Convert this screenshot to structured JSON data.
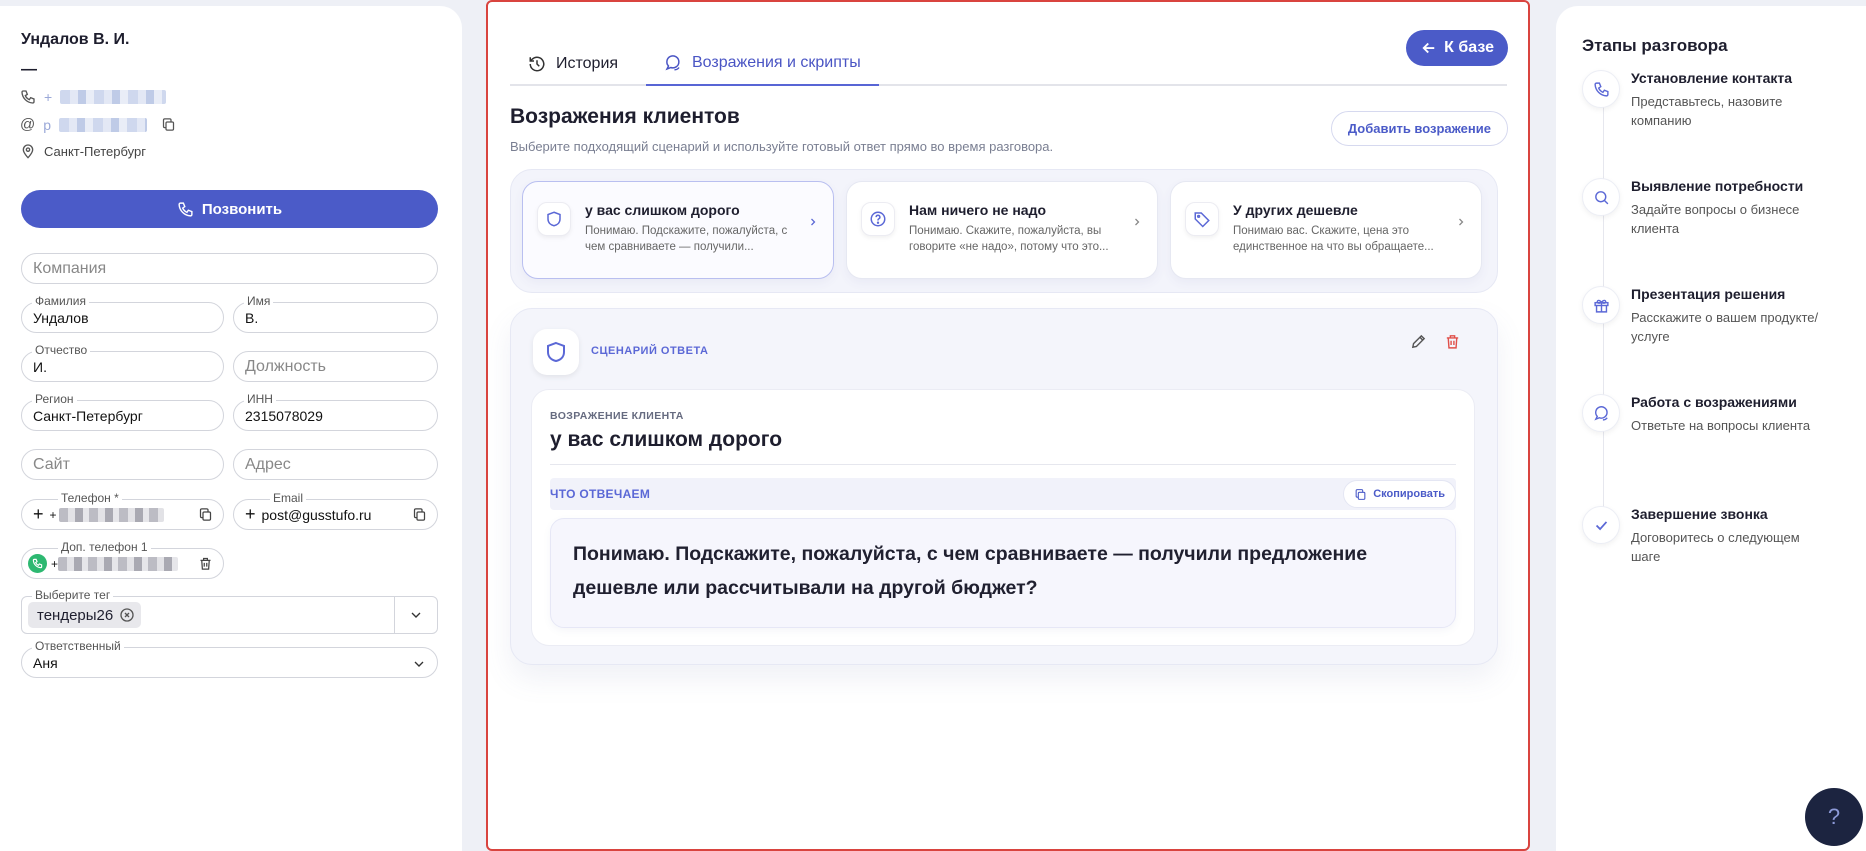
{
  "contact": {
    "name": "Ундалов В. И.",
    "dash": "—",
    "phone_prefix": "+",
    "email_prefix": "p",
    "city": "Санкт-Петербург",
    "call_label": "Позвонить"
  },
  "form": {
    "company_placeholder": "Компания",
    "lastname_label": "Фамилия",
    "lastname_value": "Ундалов",
    "firstname_label": "Имя",
    "firstname_value": "В.",
    "middlename_label": "Отчество",
    "middlename_value": "И.",
    "position_placeholder": "Должность",
    "region_label": "Регион",
    "region_value": "Санкт-Петербург",
    "inn_label": "ИНН",
    "inn_value": "2315078029",
    "site_placeholder": "Сайт",
    "address_placeholder": "Адрес",
    "phone_label": "Телефон *",
    "phone_value": "+",
    "email_label": "Email",
    "email_value": "post@gusstufo.ru",
    "extra_phone_label": "Доп. телефон 1",
    "extra_phone_value": "+",
    "tag_label": "Выберите тег",
    "tag_value": "тендеры26",
    "responsible_label": "Ответственный",
    "responsible_value": "Аня"
  },
  "center": {
    "tab_history": "История",
    "tab_objections": "Возражения и скрипты",
    "back_label": "К базе",
    "title": "Возражения клиентов",
    "subtitle": "Выберите подходящий сценарий и используйте готовый ответ прямо во время разговора.",
    "add_label": "Добавить возражение",
    "cards": [
      {
        "title": "у вас слишком дорого",
        "desc": "Понимаю. Подскажите, пожалуйста, с чем сравниваете — получили...",
        "icon": "shield-icon"
      },
      {
        "title": "Нам ничего не надо",
        "desc": "Понимаю. Скажите, пожалуйста, вы говорите «не надо», потому что это...",
        "icon": "question-icon"
      },
      {
        "title": "У других дешевле",
        "desc": "Понимаю вас. Скажите, цена это единственное на что вы обращаете...",
        "icon": "tag-icon"
      }
    ],
    "script_label": "СЦЕНАРИЙ ОТВЕТА",
    "objection_label": "ВОЗРАЖЕНИЕ КЛИЕНТА",
    "objection_text": "у вас слишком дорого",
    "answer_label": "ЧТО ОТВЕЧАЕМ",
    "copy_label": "Скопировать",
    "answer_text": "Понимаю. Подскажите, пожалуйста, с чем сравниваете — получили предложение дешевле или рассчитывали на другой бюджет?"
  },
  "stages": {
    "title": "Этапы разговора",
    "items": [
      {
        "title": "Установление контакта",
        "desc": "Представьтесь, назовите компанию",
        "icon": "phone-icon"
      },
      {
        "title": "Выявление потребности",
        "desc": "Задайте вопросы о бизнесе клиента",
        "icon": "search-icon"
      },
      {
        "title": "Презентация решения",
        "desc": "Расскажите о вашем продукте/услуге",
        "icon": "gift-icon"
      },
      {
        "title": "Работа с возражениями",
        "desc": "Ответьте на вопросы клиента",
        "icon": "chat-icon"
      },
      {
        "title": "Завершение звонка",
        "desc": "Договоритесь о следующем шаге",
        "icon": "check-icon"
      }
    ],
    "help_label": "?"
  },
  "colors": {
    "accent": "#4b5bc8",
    "highlight_border": "#d9443f",
    "danger": "#e0504a"
  }
}
